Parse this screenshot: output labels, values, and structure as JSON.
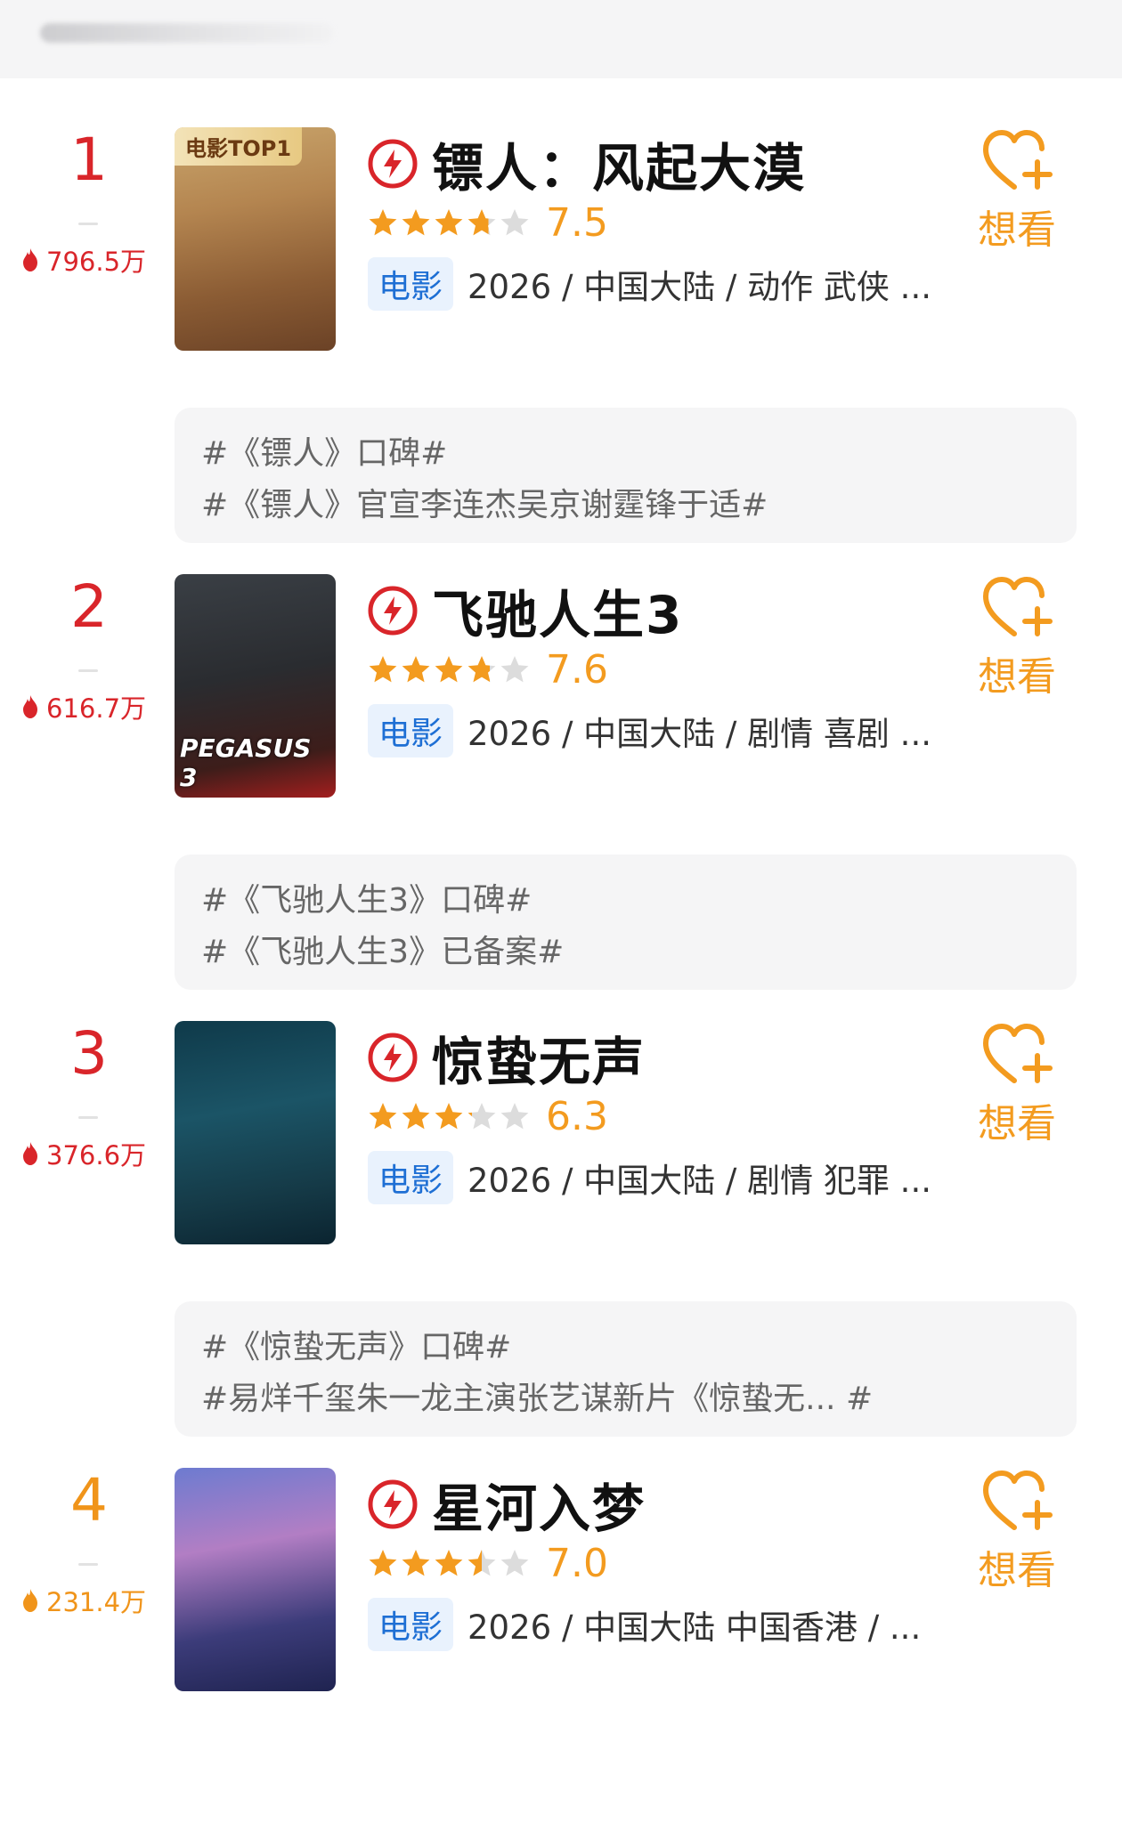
{
  "want_label": "想看",
  "type_badge": "电影",
  "colors": {
    "red": "#d9252a",
    "orange": "#f0941a",
    "star": "#f39b1f",
    "badge_text": "#1e6fd4",
    "badge_bg": "#e9f2fd"
  },
  "entries": [
    {
      "rank": "1",
      "heat": "796.5万",
      "title": "镖人：风起大漠",
      "rating": 7.5,
      "score": "7.5",
      "meta": "2026 / 中国大陆 / 动作 武侠 ...",
      "poster_tag": "电影TOP1",
      "poster_caption": "",
      "topics": [
        "#《镖人》口碑#",
        "#《镖人》官宣李连杰吴京谢霆锋于适#"
      ]
    },
    {
      "rank": "2",
      "heat": "616.7万",
      "title": "飞驰人生3",
      "rating": 7.6,
      "score": "7.6",
      "meta": "2026 / 中国大陆 / 剧情 喜剧 ...",
      "poster_tag": "",
      "poster_caption": "PEGASUS 3",
      "topics": [
        "#《飞驰人生3》口碑#",
        "#《飞驰人生3》已备案#"
      ]
    },
    {
      "rank": "3",
      "heat": "376.6万",
      "title": "惊蛰无声",
      "rating": 6.3,
      "score": "6.3",
      "meta": "2026 / 中国大陆 / 剧情 犯罪 ...",
      "poster_tag": "",
      "poster_caption": "",
      "topics": [
        "#《惊蛰无声》口碑#",
        "#易烊千玺朱一龙主演张艺谋新片《惊蛰无... #"
      ]
    },
    {
      "rank": "4",
      "heat": "231.4万",
      "title": "星河入梦",
      "rating": 7.0,
      "score": "7.0",
      "meta": "2026 / 中国大陆 中国香港 / ...",
      "poster_tag": "",
      "poster_caption": "",
      "topics": []
    }
  ]
}
